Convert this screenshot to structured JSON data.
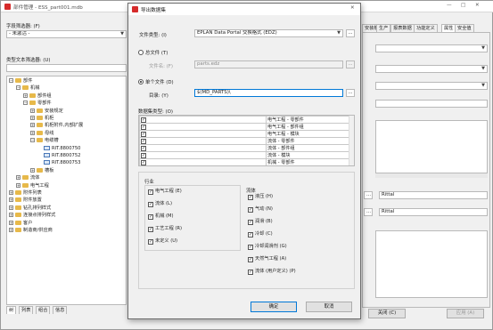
{
  "main": {
    "title": "部件管理 - ESS_part001.mdb",
    "window_controls": [
      "—",
      "□",
      "✕"
    ],
    "field_filter_label": "字段筛选器: (F)",
    "field_filter_value": "- 未激活 -",
    "text_filter_label": "类型文本筛选器: (U)",
    "text_filter_value": "",
    "tree": [
      {
        "label": "部件",
        "expander": "−",
        "kind": "folder",
        "indent": 0
      },
      {
        "label": "机械",
        "expander": "−",
        "kind": "folder",
        "indent": 1
      },
      {
        "label": "部件组",
        "expander": "+",
        "kind": "folder",
        "indent": 2
      },
      {
        "label": "零部件",
        "expander": "−",
        "kind": "folder",
        "indent": 2
      },
      {
        "label": "安装规定",
        "expander": "+",
        "kind": "folder",
        "indent": 3
      },
      {
        "label": "机柜",
        "expander": "+",
        "kind": "folder",
        "indent": 3
      },
      {
        "label": "机柜附件,内部扩展",
        "expander": "+",
        "kind": "folder",
        "indent": 3
      },
      {
        "label": "母线",
        "expander": "+",
        "kind": "folder",
        "indent": 3
      },
      {
        "label": "电缆槽",
        "expander": "−",
        "kind": "folder",
        "indent": 3
      },
      {
        "label": "RIT.8800750",
        "expander": "",
        "kind": "part",
        "indent": 4
      },
      {
        "label": "RIT.8800752",
        "expander": "",
        "kind": "part",
        "indent": 4
      },
      {
        "label": "RIT.8800753",
        "expander": "",
        "kind": "part",
        "indent": 4
      },
      {
        "label": "槽板",
        "expander": "+",
        "kind": "folder",
        "indent": 3
      },
      {
        "label": "流体",
        "expander": "+",
        "kind": "folder",
        "indent": 1
      },
      {
        "label": "电气工程",
        "expander": "+",
        "kind": "folder",
        "indent": 1
      },
      {
        "label": "附件列表",
        "expander": "+",
        "kind": "folder",
        "indent": 0
      },
      {
        "label": "附件放置",
        "expander": "+",
        "kind": "folder",
        "indent": 0
      },
      {
        "label": "钻孔排列样式",
        "expander": "+",
        "kind": "folder",
        "indent": 0
      },
      {
        "label": "连接点排列样式",
        "expander": "+",
        "kind": "folder",
        "indent": 0
      },
      {
        "label": "客户",
        "expander": "+",
        "kind": "folder",
        "indent": 0
      },
      {
        "label": "制造商/供应商",
        "expander": "+",
        "kind": "folder",
        "indent": 0
      }
    ],
    "bottom_tabs": [
      "树",
      "列表",
      "组合",
      "信息"
    ],
    "right_tabs": [
      "安装板",
      "生产",
      "报表数据",
      "功能定义",
      "属性",
      "安全值"
    ],
    "right_field_values": {
      "rittal_1": "Rittal",
      "rittal_2": "Rittal"
    },
    "right_ellipsis": "...",
    "close_button": "关闭 (C)",
    "apply_button": "应用 (A)"
  },
  "dialog": {
    "title": "导出数据集",
    "close_glyph": "✕",
    "file_type_label": "文件类型: (I)",
    "file_type_value": "EPLAN Data Portal 交换格式 (EDZ)",
    "ellipsis": "...",
    "total_file_label": "总文件 (T)",
    "file_name_label": "文件名: (F)",
    "file_name_value": "parts.edz",
    "single_file_label": "单个文件 (D)",
    "directory_label": "目录: (Y)",
    "directory_value": "$(MD_PARTS)\\",
    "dataset_types_label": "数据集类型: (O)",
    "dataset_types": [
      {
        "name": "电气工程 - 零部件",
        "checked": true
      },
      {
        "name": "电气工程 - 部件组",
        "checked": true
      },
      {
        "name": "电气工程 - 模块",
        "checked": true
      },
      {
        "name": "流体 - 零部件",
        "checked": true
      },
      {
        "name": "流体 - 部件组",
        "checked": true
      },
      {
        "name": "流体 - 模块",
        "checked": true
      },
      {
        "name": "机械 - 零部件",
        "checked": true
      }
    ],
    "industry_group": {
      "title": "行业",
      "options": [
        {
          "label": "电气工程 (E)",
          "checked": true
        },
        {
          "label": "流体 (L)",
          "checked": true
        },
        {
          "label": "机械 (M)",
          "checked": true
        },
        {
          "label": "工艺工程 (R)",
          "checked": true
        },
        {
          "label": "未定义 (U)",
          "checked": true
        }
      ]
    },
    "fluid_group": {
      "title": "流体",
      "options": [
        {
          "label": "液压 (H)",
          "checked": true
        },
        {
          "label": "气动 (N)",
          "checked": true
        },
        {
          "label": "润滑 (B)",
          "checked": true
        },
        {
          "label": "冷却 (C)",
          "checked": true
        },
        {
          "label": "冷却润滑剂 (G)",
          "checked": true
        },
        {
          "label": "天然气工程 (A)",
          "checked": true
        },
        {
          "label": "流体 (用户定义) (P)",
          "checked": true
        }
      ]
    },
    "ok_button": "确定",
    "cancel_button": "取消"
  },
  "colors": {
    "accent": "#0078d7",
    "folder": "#e7b94a",
    "app_icon": "#d62b2b"
  }
}
